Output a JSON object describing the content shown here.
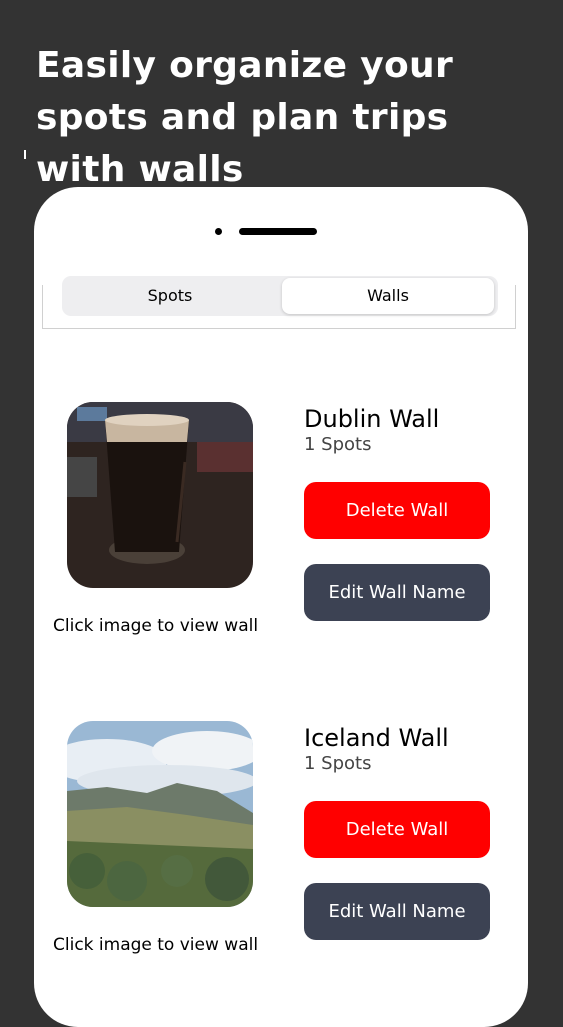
{
  "promo": {
    "headline": "Easily organize your spots and plan trips with walls"
  },
  "tabs": {
    "spots_label": "Spots",
    "walls_label": "Walls",
    "selected": "Walls"
  },
  "walls": [
    {
      "name": "Dublin Wall",
      "count": "1 Spots",
      "delete_label": "Delete Wall",
      "edit_label": "Edit Wall Name",
      "caption": "Click image to view wall",
      "image": "pint-of-stout-photo"
    },
    {
      "name": "Iceland Wall",
      "count": "1 Spots",
      "delete_label": "Delete Wall",
      "edit_label": "Edit Wall Name",
      "caption": "Click image to view wall",
      "image": "icelandic-landscape-photo"
    }
  ],
  "colors": {
    "background": "#333333",
    "delete": "#ff0000",
    "edit": "#3c4253"
  }
}
